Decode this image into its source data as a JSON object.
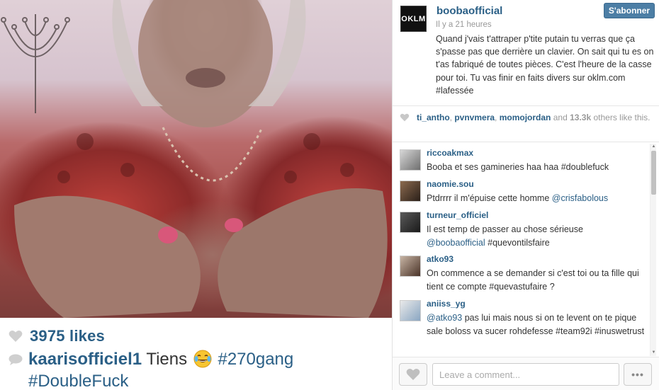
{
  "photo": {
    "description_icon": "photo-image"
  },
  "overlay": {
    "likes_count": "3975 likes",
    "caption_user": "kaarisofficiel1",
    "caption_text": "Tiens",
    "caption_emoji": "face-with-tears-of-joy-icon",
    "caption_tag1": "#270gang",
    "caption_tag2": "#DoubleFuck"
  },
  "post": {
    "avatar_label": "OKLM",
    "author": "boobaofficial",
    "time": "Il y a 21 heures",
    "follow_label": "S'abonner",
    "caption_text": "Quand j'vais t'attraper p'tite putain tu verras que ça s'passe pas que derrière un clavier. On sait qui tu es on t'as fabriqué de toutes pièces. C'est l'heure de la casse pour toi. Tu vas finir en faits divers sur oklm.com",
    "caption_tag": "#lafessée"
  },
  "likes": {
    "users": [
      "ti_antho",
      "pvnvmera",
      "momojordan"
    ],
    "and_text": "and",
    "others_count": "13.3k",
    "others_text": "others like this."
  },
  "comments": [
    {
      "user": "riccoakmax",
      "text": "Booba et ses gamineries haa haa #doublefuck"
    },
    {
      "user": "naomie.sou",
      "text_before": "Ptdrrrr il m'épuise cette homme ",
      "mention": "@crisfabolous"
    },
    {
      "user": "turneur_officiel",
      "text": "Il est temp de passer au chose sérieuse",
      "mention": "@boobaofficial",
      "text_after": " #quevontilsfaire"
    },
    {
      "user": "atko93",
      "text": "On commence a se demander si c'est toi ou ta fille qui tient ce compte #quevastufaire ?"
    },
    {
      "user": "aniiss_yg",
      "mention": "@atko93",
      "text": " pas lui mais nous si on te levent on te pique sale boloss va sucer rohdefesse #team92i #inuswetrust"
    }
  ],
  "footer": {
    "comment_placeholder": "Leave a comment...",
    "more_label": "•••"
  },
  "colors": {
    "link": "#2a5f86",
    "follow_button": "#4c7ea5",
    "muted": "#999999"
  }
}
